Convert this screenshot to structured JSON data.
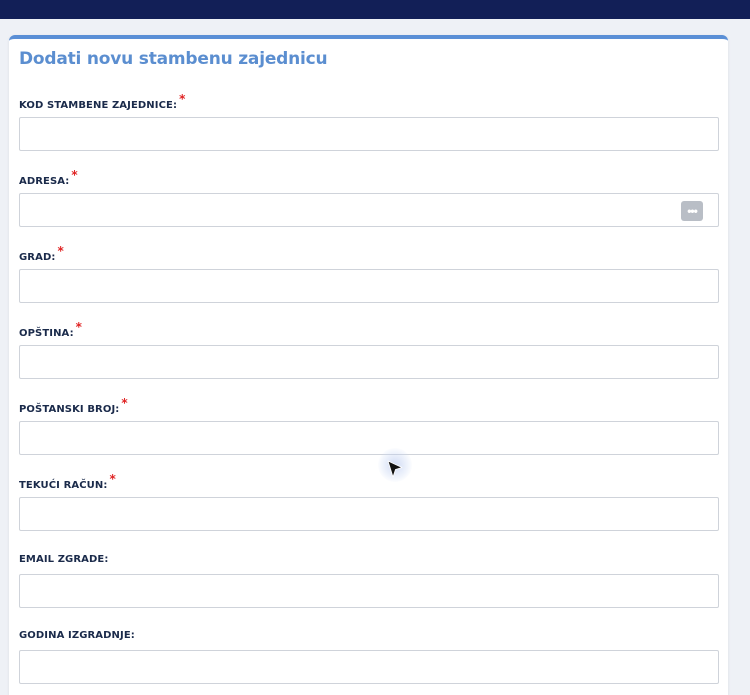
{
  "form": {
    "title": "Dodati novu stambenu zajednicu",
    "fields": [
      {
        "label": "KOD STAMBENE ZAJEDNICE:",
        "required": "*",
        "value": ""
      },
      {
        "label": "ADRESA:",
        "required": "*",
        "value": "",
        "action_icon": "more-options-icon"
      },
      {
        "label": "GRAD:",
        "required": "*",
        "value": ""
      },
      {
        "label": "OPŠTINA:",
        "required": "*",
        "value": ""
      },
      {
        "label": "POŠTANSKI BROJ:",
        "required": "*",
        "value": ""
      },
      {
        "label": "TEKUĆI RAČUN:",
        "required": "*",
        "value": ""
      },
      {
        "label": "EMAIL ZGRADE:",
        "value": ""
      },
      {
        "label": "GODINA IZGRADNJE:",
        "value": ""
      }
    ]
  },
  "colors": {
    "topbar": "#121f57",
    "title": "#5b8ed0",
    "card_accent": "#5a8fd6",
    "required_marker": "#e02424",
    "label": "#1a2a4a"
  }
}
